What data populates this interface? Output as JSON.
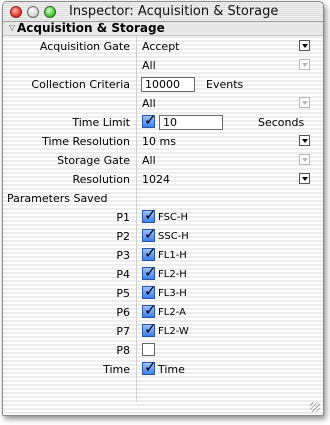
{
  "window": {
    "title": "Inspector: Acquisition & Storage"
  },
  "section": {
    "title": "Acquisition & Storage"
  },
  "rows": {
    "acq_gate": {
      "label": "Acquisition Gate",
      "value": "Accept"
    },
    "acq_gate_sub": {
      "value": "All"
    },
    "collection": {
      "label": "Collection Criteria",
      "value": "10000",
      "unit": "Events"
    },
    "collection_sub": {
      "value": "All"
    },
    "time_limit": {
      "label": "Time Limit",
      "value": "10",
      "unit": "Seconds",
      "checked": true
    },
    "time_resolution": {
      "label": "Time Resolution",
      "value": "10 ms"
    },
    "storage_gate": {
      "label": "Storage Gate",
      "value": "All"
    },
    "resolution": {
      "label": "Resolution",
      "value": "1024"
    },
    "params_header": {
      "label": "Parameters Saved"
    }
  },
  "parameters": [
    {
      "label": "P1",
      "name": "FSC-H",
      "checked": true
    },
    {
      "label": "P2",
      "name": "SSC-H",
      "checked": true
    },
    {
      "label": "P3",
      "name": "FL1-H",
      "checked": true
    },
    {
      "label": "P4",
      "name": "FL2-H",
      "checked": true
    },
    {
      "label": "P5",
      "name": "FL3-H",
      "checked": true
    },
    {
      "label": "P6",
      "name": "FL2-A",
      "checked": true
    },
    {
      "label": "P7",
      "name": "FL2-W",
      "checked": true
    },
    {
      "label": "P8",
      "name": "",
      "checked": false
    },
    {
      "label": "Time",
      "name": "Time",
      "checked": true
    }
  ]
}
